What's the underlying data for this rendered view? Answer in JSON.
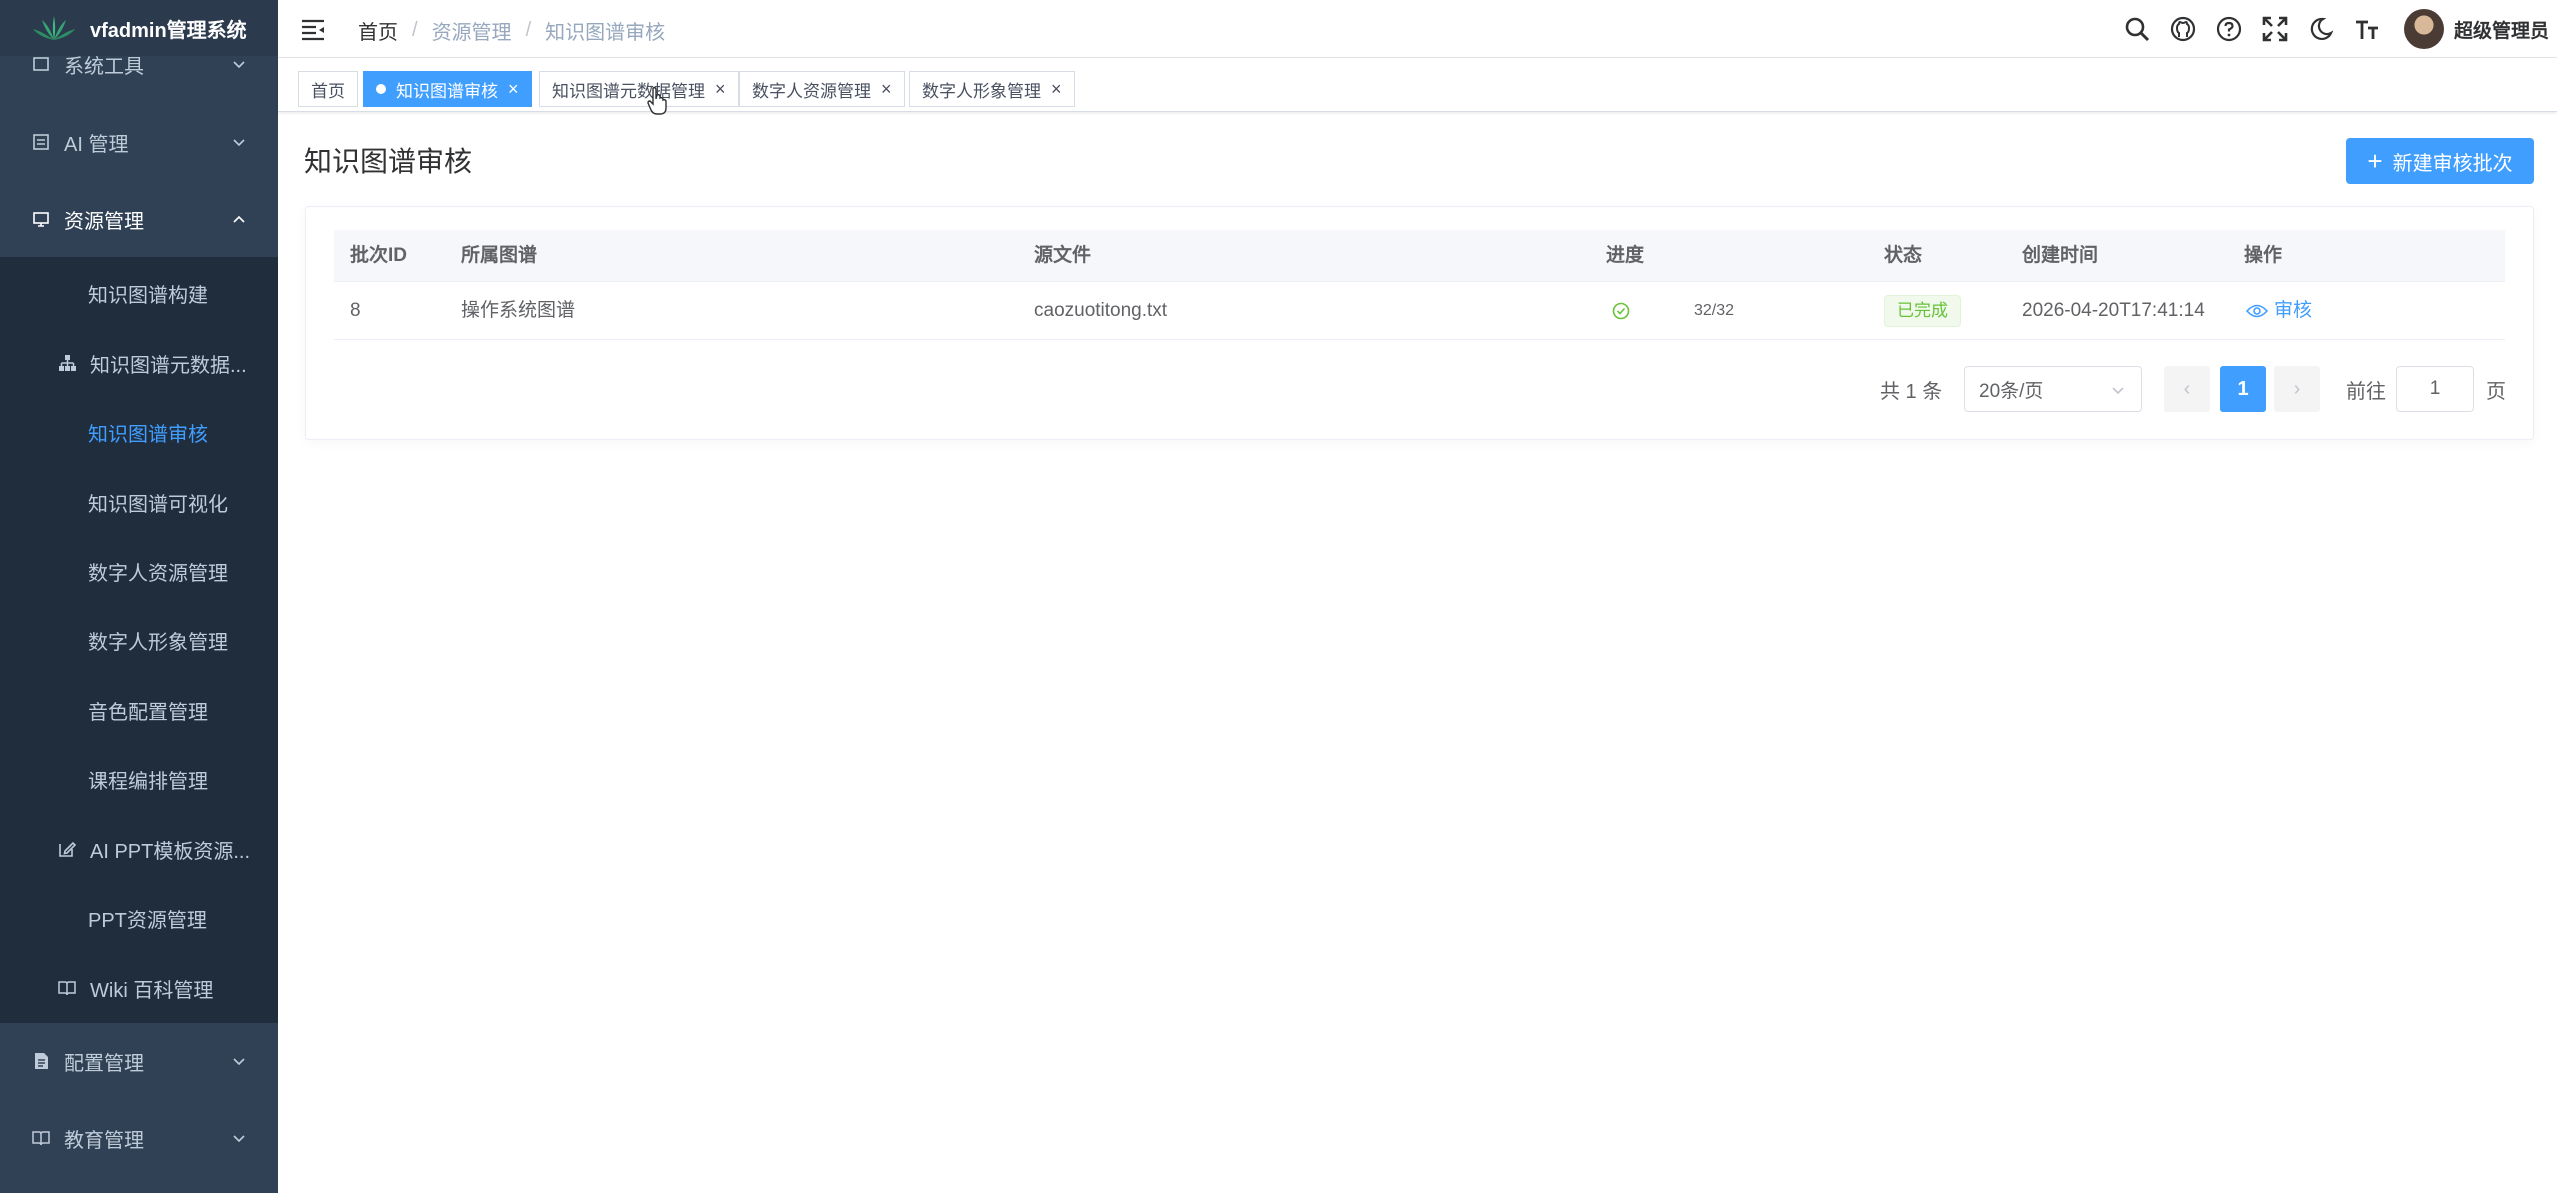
{
  "app": {
    "title": "vfadmin管理系统"
  },
  "sidebar": {
    "items": [
      {
        "label": "系统工具"
      },
      {
        "label": "AI 管理"
      },
      {
        "label": "资源管理"
      },
      {
        "label": "知识图谱构建"
      },
      {
        "label": "知识图谱元数据..."
      },
      {
        "label": "知识图谱审核"
      },
      {
        "label": "知识图谱可视化"
      },
      {
        "label": "数字人资源管理"
      },
      {
        "label": "数字人形象管理"
      },
      {
        "label": "音色配置管理"
      },
      {
        "label": "课程编排管理"
      },
      {
        "label": "AI PPT模板资源..."
      },
      {
        "label": "PPT资源管理"
      },
      {
        "label": "Wiki 百科管理"
      },
      {
        "label": "配置管理"
      },
      {
        "label": "教育管理"
      }
    ]
  },
  "header": {
    "breadcrumb": [
      "首页",
      "资源管理",
      "知识图谱审核"
    ],
    "user_name": "超级管理员"
  },
  "tags": [
    {
      "label": "首页"
    },
    {
      "label": "知识图谱审核"
    },
    {
      "label": "知识图谱元数据管理"
    },
    {
      "label": "数字人资源管理"
    },
    {
      "label": "数字人形象管理"
    }
  ],
  "tag_close": "×",
  "main": {
    "title": "知识图谱审核",
    "new_button": "新建审核批次",
    "new_button_icon": "+"
  },
  "table": {
    "columns": [
      "批次ID",
      "所属图谱",
      "源文件",
      "进度",
      "状态",
      "创建时间",
      "操作"
    ],
    "rows": [
      {
        "id": "8",
        "graph": "操作系统图谱",
        "file": "caozuotitong.txt",
        "progress": "32/32",
        "status": "已完成",
        "created": "2026-04-20T17:41:14",
        "action": "审核"
      }
    ]
  },
  "pagination": {
    "total": "共 1 条",
    "page_size": "20条/页",
    "prev": "‹",
    "next": "›",
    "current": "1",
    "goto_label": "前往",
    "goto_value": "1",
    "page_unit": "页"
  },
  "colors": {
    "primary": "#409eff",
    "sidebar_bg": "#304156",
    "submenu_bg": "#1f2d3d",
    "success": "#67c23a"
  }
}
